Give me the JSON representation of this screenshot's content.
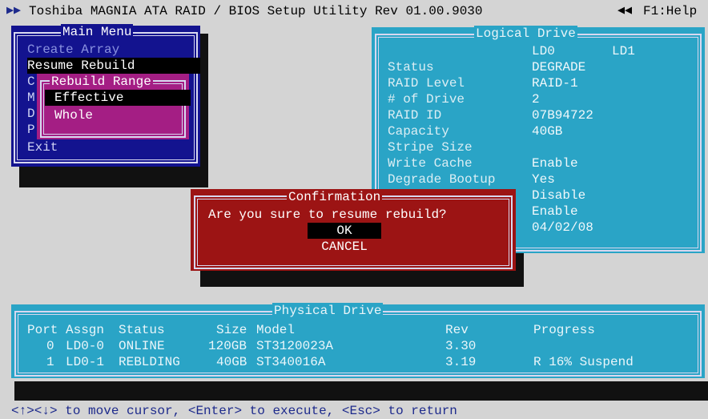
{
  "title_bar": {
    "arrows": "▶▶",
    "text": "Toshiba MAGNIA ATA RAID / BIOS Setup Utility Rev 01.00.9030",
    "back_arrows": "◀◀",
    "help": "F1:Help"
  },
  "main_menu": {
    "title": "Main Menu",
    "items": [
      {
        "label": "Create Array"
      },
      {
        "label": "Resume Rebuild"
      },
      {
        "label": "C"
      },
      {
        "label": "M"
      },
      {
        "label": "D"
      },
      {
        "label": "P"
      },
      {
        "label": "Exit"
      }
    ]
  },
  "rebuild_range": {
    "title": "Rebuild Range",
    "items": [
      {
        "label": "Effective"
      },
      {
        "label": "Whole"
      }
    ]
  },
  "logical_drive": {
    "title": "Logical Drive",
    "columns": [
      "LD0",
      "LD1"
    ],
    "rows": [
      {
        "label": "Status",
        "value": "DEGRADE"
      },
      {
        "label": "RAID Level",
        "value": "RAID-1"
      },
      {
        "label": "# of Drive",
        "value": "2"
      },
      {
        "label": "RAID ID",
        "value": "07B94722"
      },
      {
        "label": "Capacity",
        "value": "40GB"
      },
      {
        "label": "Stripe Size",
        "value": ""
      },
      {
        "label": "Write Cache",
        "value": "Enable"
      },
      {
        "label": "Degrade Bootup",
        "value": "Yes"
      },
      {
        "label": "",
        "value": "Disable"
      },
      {
        "label": "",
        "value": "Enable"
      },
      {
        "label": "",
        "value": "04/02/08"
      }
    ]
  },
  "confirmation": {
    "title": "Confirmation",
    "message": "Are you sure to resume rebuild?",
    "ok": "OK",
    "cancel": "CANCEL"
  },
  "physical_drive": {
    "title": "Physical Drive",
    "headers": {
      "port": "Port",
      "assign": "Assgn",
      "status": "Status",
      "size": "Size",
      "model": "Model",
      "rev": "Rev",
      "progress": "Progress"
    },
    "rows": [
      {
        "port": "0",
        "assign": "LD0-0",
        "status": "ONLINE",
        "size": "120GB",
        "model": "ST3120023A",
        "rev": "3.30",
        "progress": ""
      },
      {
        "port": "1",
        "assign": "LD0-1",
        "status": "REBLDING",
        "size": "40GB",
        "model": "ST340016A",
        "rev": "3.19",
        "progress": "R 16% Suspend"
      }
    ]
  },
  "status_line": "<↑><↓> to move cursor, <Enter> to execute, <Esc> to return"
}
